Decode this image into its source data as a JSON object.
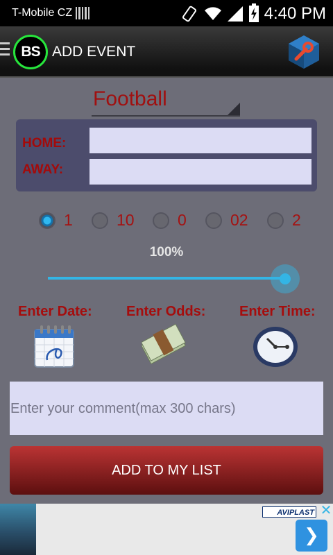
{
  "status": {
    "carrier": "T-Mobile CZ",
    "time": "4:40 PM"
  },
  "header": {
    "logo_text": "BS",
    "title": "ADD EVENT"
  },
  "sport": {
    "selected": "Football"
  },
  "teams": {
    "home_label": "HOME:",
    "away_label": "AWAY:",
    "home_value": "",
    "away_value": ""
  },
  "stake_options": [
    {
      "label": "1",
      "checked": true
    },
    {
      "label": "10",
      "checked": false
    },
    {
      "label": "0",
      "checked": false
    },
    {
      "label": "02",
      "checked": false
    },
    {
      "label": "2",
      "checked": false
    }
  ],
  "slider": {
    "label": "100%",
    "value": 1.0
  },
  "entries": {
    "date_label": "Enter Date:",
    "odds_label": "Enter Odds:",
    "time_label": "Enter Time:"
  },
  "comment": {
    "placeholder": "Enter your comment(max 300 chars)"
  },
  "add_button": {
    "label": "ADD TO MY LIST"
  },
  "ad": {
    "brand": "AVIPLAST",
    "close_icon": "close-icon",
    "next_icon": "chevron-right-icon"
  },
  "colors": {
    "accent": "#33b5e5",
    "label_red": "#a50d0d",
    "button_red": "#bb3434",
    "input_bg": "#dcdcf4",
    "logo_ring": "#27e63c"
  }
}
